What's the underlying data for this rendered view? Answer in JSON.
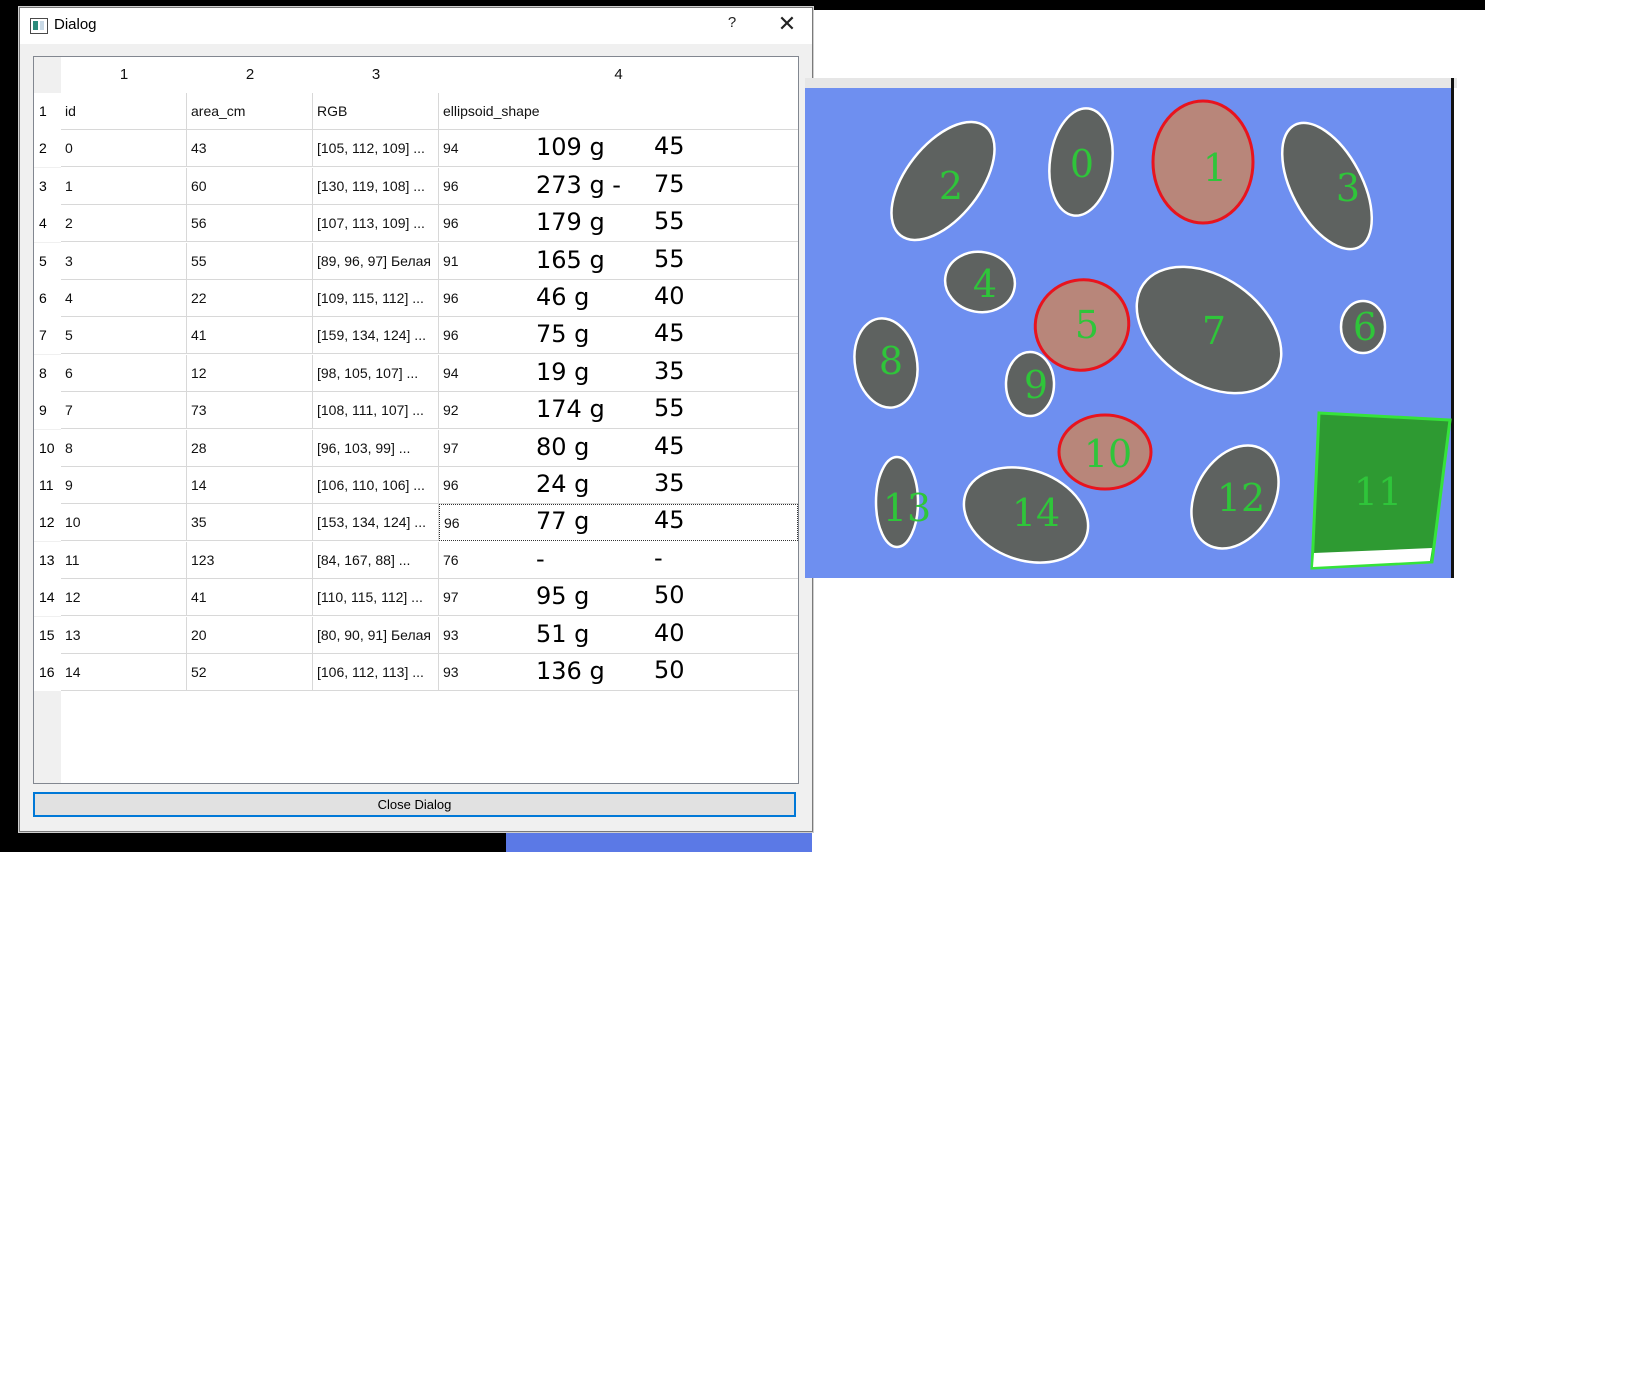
{
  "window": {
    "title": "Dialog",
    "help": "?",
    "close": "✕",
    "icon": "app-window-icon"
  },
  "table": {
    "column_numbers": [
      "1",
      "2",
      "3",
      "4"
    ],
    "rows": [
      {
        "num": "1",
        "c1": "id",
        "c2": "area_cm",
        "c3": "RGB",
        "c4": "ellipsoid_shape",
        "mass": "",
        "size": ""
      },
      {
        "num": "2",
        "c1": "0",
        "c2": "43",
        "c3": "[105, 112, 109] ...",
        "c4": "94",
        "mass": "109 g",
        "size": "45"
      },
      {
        "num": "3",
        "c1": "1",
        "c2": "60",
        "c3": "[130, 119, 108] ...",
        "c4": "96",
        "mass": "273 g -",
        "size": "75"
      },
      {
        "num": "4",
        "c1": "2",
        "c2": "56",
        "c3": "[107, 113, 109] ...",
        "c4": "96",
        "mass": "179 g",
        "size": "55"
      },
      {
        "num": "5",
        "c1": "3",
        "c2": "55",
        "c3": "[89, 96, 97] Белая",
        "c4": "91",
        "mass": "165 g",
        "size": "55"
      },
      {
        "num": "6",
        "c1": "4",
        "c2": "22",
        "c3": "[109, 115, 112] ...",
        "c4": "96",
        "mass": "46 g",
        "size": "40"
      },
      {
        "num": "7",
        "c1": "5",
        "c2": "41",
        "c3": "[159, 134, 124] ...",
        "c4": "96",
        "mass": "75 g",
        "size": "45"
      },
      {
        "num": "8",
        "c1": "6",
        "c2": "12",
        "c3": "[98, 105, 107] ...",
        "c4": "94",
        "mass": "19 g",
        "size": "35"
      },
      {
        "num": "9",
        "c1": "7",
        "c2": "73",
        "c3": "[108, 111, 107] ...",
        "c4": "92",
        "mass": "174 g",
        "size": "55"
      },
      {
        "num": "10",
        "c1": "8",
        "c2": "28",
        "c3": "[96, 103, 99] ...",
        "c4": "97",
        "mass": "80 g",
        "size": "45"
      },
      {
        "num": "11",
        "c1": "9",
        "c2": "14",
        "c3": "[106, 110, 106] ...",
        "c4": "96",
        "mass": "24 g",
        "size": "35"
      },
      {
        "num": "12",
        "c1": "10",
        "c2": "35",
        "c3": "[153, 134, 124] ...",
        "c4": "96",
        "mass": "77 g",
        "size": "45"
      },
      {
        "num": "13",
        "c1": "11",
        "c2": "123",
        "c3": "[84, 167, 88] ...",
        "c4": "76",
        "mass": "-",
        "size": "-"
      },
      {
        "num": "14",
        "c1": "12",
        "c2": "41",
        "c3": "[110, 115, 112] ...",
        "c4": "97",
        "mass": "95 g",
        "size": "50"
      },
      {
        "num": "15",
        "c1": "13",
        "c2": "20",
        "c3": "[80, 90, 91] Белая",
        "c4": "93",
        "mass": "51 g",
        "size": "40"
      },
      {
        "num": "16",
        "c1": "14",
        "c2": "52",
        "c3": "[106, 112, 113] ...",
        "c4": "93",
        "mass": "136 g",
        "size": "50"
      }
    ]
  },
  "buttons": {
    "close_dialog": "Close Dialog"
  },
  "photo": {
    "background_color": "#6e8ff0",
    "potato_color": "#5e6260",
    "label_color": "#2fc53a",
    "outline_normal": "#ffffff",
    "outline_red": "#e8141e",
    "outline_reference": "#35e33a",
    "objects": [
      {
        "label": "0",
        "outline": "white"
      },
      {
        "label": "1",
        "outline": "red"
      },
      {
        "label": "2",
        "outline": "white"
      },
      {
        "label": "3",
        "outline": "white"
      },
      {
        "label": "4",
        "outline": "white"
      },
      {
        "label": "5",
        "outline": "red"
      },
      {
        "label": "6",
        "outline": "white"
      },
      {
        "label": "7",
        "outline": "white"
      },
      {
        "label": "8",
        "outline": "white"
      },
      {
        "label": "9",
        "outline": "white"
      },
      {
        "label": "10",
        "outline": "red"
      },
      {
        "label": "11",
        "outline": "green"
      },
      {
        "label": "12",
        "outline": "white"
      },
      {
        "label": "13",
        "outline": "white"
      },
      {
        "label": "14",
        "outline": "white"
      }
    ]
  }
}
